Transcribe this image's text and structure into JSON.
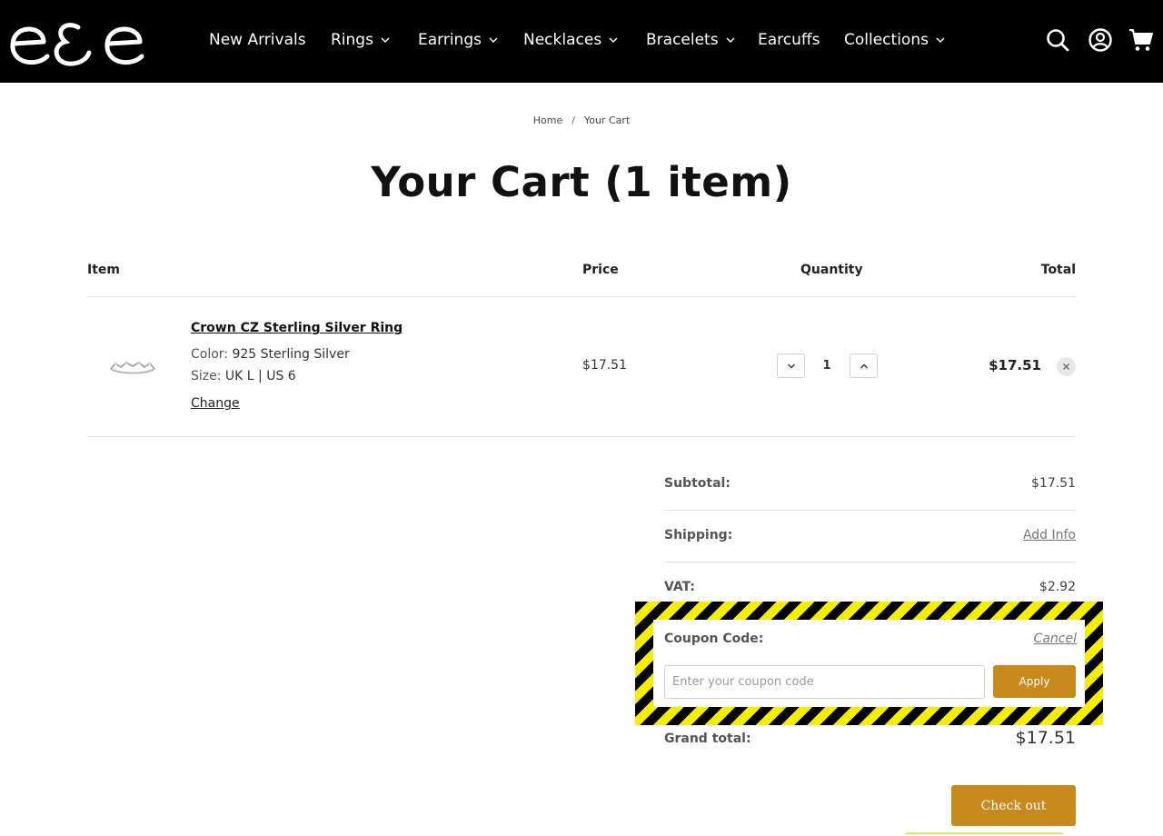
{
  "header": {
    "logo_text": "e&e",
    "nav": [
      {
        "label": "New Arrivals",
        "has_dropdown": false
      },
      {
        "label": "Rings",
        "has_dropdown": true
      },
      {
        "label": "Earrings",
        "has_dropdown": true
      },
      {
        "label": "Necklaces",
        "has_dropdown": true
      },
      {
        "label": "Bracelets",
        "has_dropdown": true
      },
      {
        "label": "Earcuffs",
        "has_dropdown": false
      },
      {
        "label": "Collections",
        "has_dropdown": true
      }
    ],
    "icons": [
      "search-icon",
      "account-icon",
      "cart-icon"
    ]
  },
  "breadcrumb": {
    "home": "Home",
    "separator": "/",
    "current": "Your Cart"
  },
  "page_title": "Your Cart (1 item)",
  "table": {
    "headers": {
      "item": "Item",
      "price": "Price",
      "quantity": "Quantity",
      "total": "Total"
    },
    "rows": [
      {
        "name": "Crown CZ Sterling Silver Ring",
        "color_label": "Color:",
        "color_value": "925 Sterling Silver",
        "size_label": "Size:",
        "size_value": "UK L | US 6",
        "change_label": "Change",
        "price": "$17.51",
        "quantity": "1",
        "total": "$17.51"
      }
    ]
  },
  "summary": {
    "subtotal_label": "Subtotal:",
    "subtotal_value": "$17.51",
    "shipping_label": "Shipping:",
    "shipping_value": "Add Info",
    "vat_label": "VAT:",
    "vat_value": "$2.92",
    "coupon_label": "Coupon Code:",
    "coupon_cancel": "Cancel",
    "coupon_placeholder": "Enter your coupon code",
    "apply_label": "Apply",
    "grand_total_label": "Grand total:",
    "grand_total_value": "$17.51",
    "checkout_label": "Check out"
  },
  "colors": {
    "header_bg": "#000000",
    "accent": "#c8891f",
    "highlight_stripe_yellow": "#f5ee00",
    "highlight_stripe_black": "#000000"
  }
}
